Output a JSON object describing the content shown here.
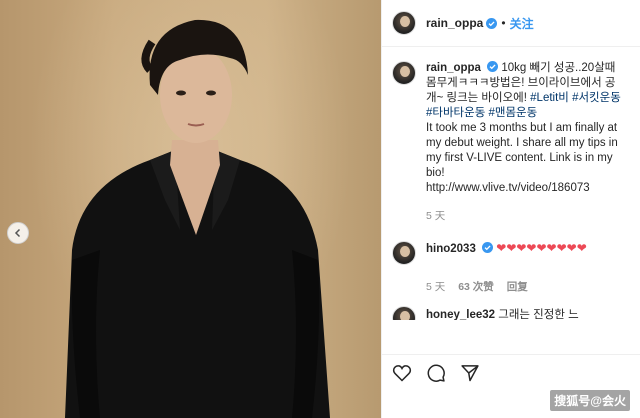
{
  "post": {
    "username": "rain_oppa",
    "follow_label": "关注",
    "dot": "•"
  },
  "caption": {
    "username": "rain_oppa",
    "korean_text": "10kg 빼기 성공..20살때 몸무게ㅋㅋㅋ방법은! 브이라이브에서 공개~ 링크는 바이오에!",
    "hashtags": [
      "#Letit비",
      "#서킷운동",
      "#타바타운동",
      "#맨몸운동"
    ],
    "english_text": "It took me 3 months but I am finally at my debut weight. I share all my tips in my first V-LIVE content. Link is in my bio!",
    "link": "http://www.vlive.tv/video/186073",
    "time": "5 天"
  },
  "comment": {
    "username": "hino2033",
    "hearts": "❤❤❤❤❤❤❤❤❤",
    "time": "5 天",
    "likes": "63 次赞",
    "reply": "回复"
  },
  "partial_comment": {
    "username": "honey_lee32",
    "text": "그래는 진정한 느"
  },
  "watermark": "搜狐号@会火",
  "colors": {
    "accent": "#3897f0",
    "hashtag": "#003569",
    "heart": "#ed4956",
    "meta": "#8e8e8e"
  },
  "icons": [
    "chevron-left-icon",
    "verified-badge-icon",
    "heart-icon",
    "comment-icon",
    "share-icon"
  ]
}
